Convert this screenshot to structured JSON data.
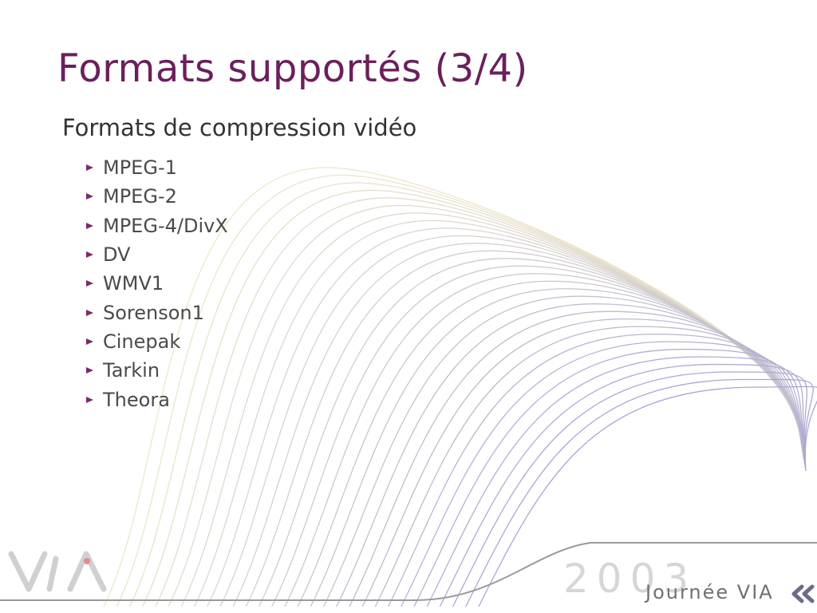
{
  "slide": {
    "title": "Formats supportés (3/4)",
    "subtitle": "Formats de compression vidéo",
    "bullets": [
      "MPEG-1",
      "MPEG-2",
      "MPEG-4/DivX",
      "DV",
      "WMV1",
      "Sorenson1",
      "Cinepak",
      "Tarkin",
      "Theora"
    ]
  },
  "footer": {
    "year": "2003",
    "event": "Journée VIA",
    "logo_text": "VIA",
    "chevron_icon": "double-chevron-left-icon"
  },
  "colors": {
    "title": "#6b1f5c",
    "text": "#4a4a4a",
    "bullet_marker": "#7a2a6a",
    "wave_light": "#ede6cc",
    "wave_dark": "#aaa5d2",
    "footer_line": "#9a9a9a",
    "year": "#d6d6d6"
  }
}
